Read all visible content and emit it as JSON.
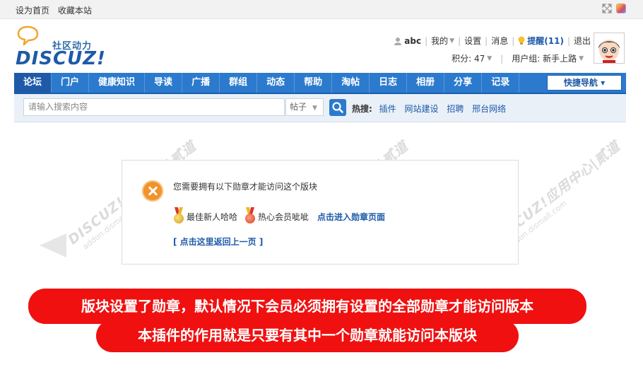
{
  "topbar": {
    "set_home": "设为首页",
    "bookmark": "收藏本站"
  },
  "logo": {
    "slogan": "社区动力",
    "brand": "DISCUZ!"
  },
  "user": {
    "name": "abc",
    "mine": "我的",
    "settings": "设置",
    "messages": "消息",
    "remind": "提醒(11)",
    "logout": "退出",
    "points": "积分: 47",
    "group": "用户组: 新手上路"
  },
  "nav": {
    "items": [
      "论坛",
      "门户",
      "健康知识",
      "导读",
      "广播",
      "群组",
      "动态",
      "帮助",
      "淘帖",
      "日志",
      "相册",
      "分享",
      "记录"
    ],
    "quick": "快捷导航 ▾"
  },
  "search": {
    "placeholder": "请输入搜索内容",
    "type": "帖子",
    "hot_label": "热搜:",
    "hot": [
      "插件",
      "网站建设",
      "招聘",
      "邢台网络"
    ]
  },
  "message": {
    "text": "您需要拥有以下勋章才能访问这个版块",
    "medals": [
      "最佳新人哈哈",
      "热心会员呲呲"
    ],
    "medal_link": "点击进入勋章页面",
    "back": "[ 点击这里返回上一页 ]"
  },
  "banners": {
    "line1": "版块设置了勋章，默认情况下会员必须拥有设置的全部勋章才能访问版本",
    "line2": "本插件的作用就是只要有其中一个勋章就能访问本版块"
  },
  "watermark": {
    "brand": "DISCUZ!应用中心|贰道",
    "url": "addon.dismall.com"
  }
}
